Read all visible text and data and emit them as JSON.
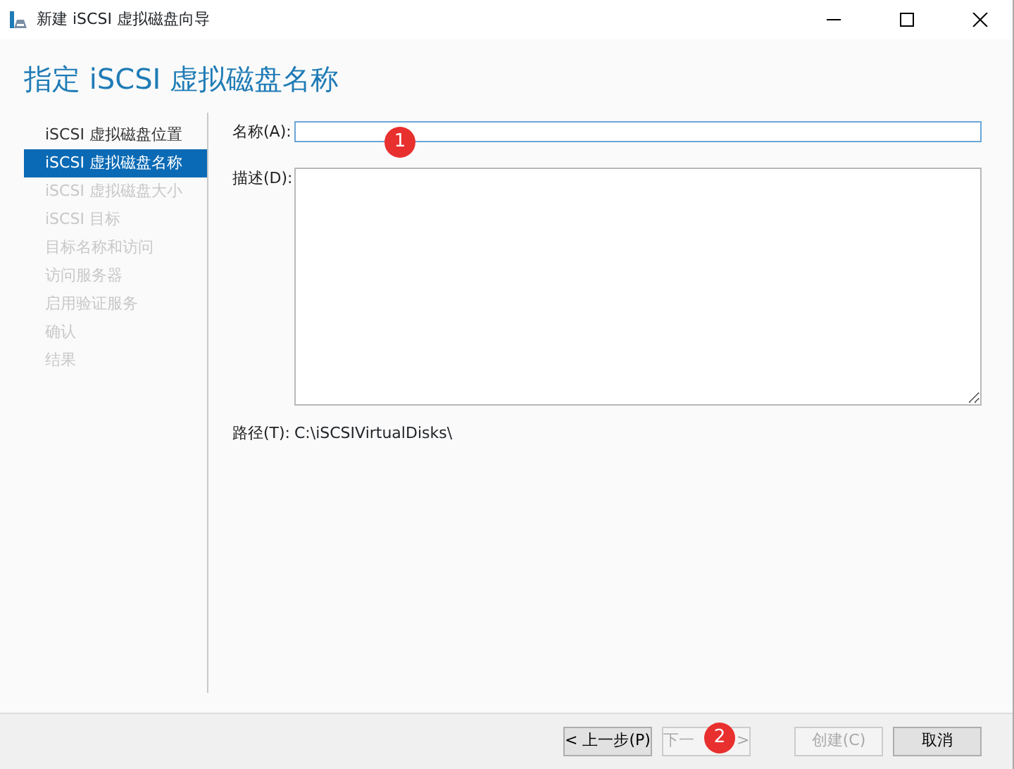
{
  "window": {
    "title": "新建 iSCSI 虚拟磁盘向导"
  },
  "heading": "指定 iSCSI 虚拟磁盘名称",
  "steps": [
    {
      "label": "iSCSI 虚拟磁盘位置",
      "selected": false,
      "disabled": false
    },
    {
      "label": "iSCSI 虚拟磁盘名称",
      "selected": true,
      "disabled": false
    },
    {
      "label": "iSCSI 虚拟磁盘大小",
      "selected": false,
      "disabled": true
    },
    {
      "label": "iSCSI 目标",
      "selected": false,
      "disabled": true
    },
    {
      "label": "目标名称和访问",
      "selected": false,
      "disabled": true
    },
    {
      "label": "访问服务器",
      "selected": false,
      "disabled": true
    },
    {
      "label": "启用验证服务",
      "selected": false,
      "disabled": true
    },
    {
      "label": "确认",
      "selected": false,
      "disabled": true
    },
    {
      "label": "结果",
      "selected": false,
      "disabled": true
    }
  ],
  "form": {
    "name_label": "名称(A):",
    "description_label": "描述(D):",
    "path_label": "路径(T):",
    "path_value": "C:\\iSCSIVirtualDisks\\"
  },
  "buttons": [
    {
      "label": "< 上一步(P)",
      "disabled": false
    },
    {
      "label": "下一",
      "tail": ">",
      "disabled": true
    },
    {
      "label": "创建(C)",
      "disabled": true
    },
    {
      "label": "取消",
      "disabled": false
    }
  ],
  "annotations": [
    {
      "text": "1"
    },
    {
      "text": "2"
    }
  ]
}
